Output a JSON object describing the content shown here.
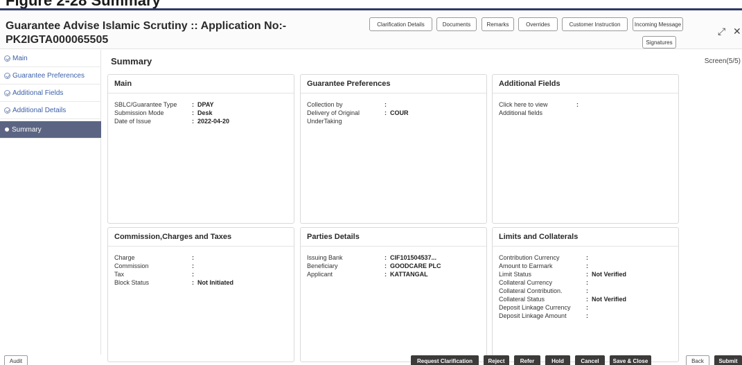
{
  "doc_heading": "Figure 2-28   Summary",
  "window": {
    "title_line1": "Guarantee Advise Islamic Scrutiny :: Application No:-",
    "title_line2": "PK2IGTA000065505",
    "header_buttons": [
      "Clarification Details",
      "Documents",
      "Remarks",
      "Overrides",
      "Customer Instruction",
      "Incoming Message"
    ],
    "signatures_label": "Signatures",
    "expand_icon": "expand-icon",
    "close_icon": "close-icon",
    "expand_glyph": "⤢",
    "close_glyph": "✕"
  },
  "sidebar": {
    "items": [
      {
        "label": "Main",
        "done": true
      },
      {
        "label": "Guarantee Preferences",
        "done": true
      },
      {
        "label": "Additional Fields",
        "done": true
      },
      {
        "label": "Additional Details",
        "done": true
      },
      {
        "label": "Summary",
        "active": true
      }
    ]
  },
  "page": {
    "title": "Summary",
    "screen_indicator": "Screen(5/5)"
  },
  "cards": {
    "main": {
      "title": "Main",
      "rows": [
        {
          "label": "SBLC/Guarantee Type",
          "sep": ":",
          "value": "DPAY"
        },
        {
          "label": "Submission Mode",
          "sep": ":",
          "value": "Desk"
        },
        {
          "label": "Date of Issue",
          "sep": ":",
          "value": "2022-04-20"
        }
      ]
    },
    "guarantee_preferences": {
      "title": "Guarantee Preferences",
      "rows": [
        {
          "label": "Collection by",
          "sep": ":",
          "value": ""
        },
        {
          "label": "Delivery of Original UnderTaking",
          "sep": ":",
          "value": "COUR"
        }
      ]
    },
    "additional_fields": {
      "title": "Additional Fields",
      "rows": [
        {
          "label": "Click here to view Additional fields",
          "sep": ":",
          "value": ""
        }
      ]
    },
    "commission": {
      "title": "Commission,Charges and Taxes",
      "rows": [
        {
          "label": "Charge",
          "sep": ":",
          "value": ""
        },
        {
          "label": "Commission",
          "sep": ":",
          "value": ""
        },
        {
          "label": "Tax",
          "sep": ":",
          "value": ""
        },
        {
          "label": "Block Status",
          "sep": ":",
          "value": "Not Initiated"
        }
      ]
    },
    "parties": {
      "title": "Parties Details",
      "rows": [
        {
          "label": "Issuing Bank",
          "sep": ":",
          "value": "CIF101504537..."
        },
        {
          "label": "Beneficiary",
          "sep": ":",
          "value": "GOODCARE PLC"
        },
        {
          "label": "Applicant",
          "sep": ":",
          "value": "KATTANGAL"
        }
      ]
    },
    "limits": {
      "title": "Limits and Collaterals",
      "rows": [
        {
          "label": "Contribution Currency",
          "sep": ":",
          "value": ""
        },
        {
          "label": "Amount to Earmark",
          "sep": ":",
          "value": ""
        },
        {
          "label": "Limit Status",
          "sep": ":",
          "value": "Not Verified"
        },
        {
          "label": "Collateral Currency",
          "sep": ":",
          "value": ""
        },
        {
          "label": "Collateral Contribution.",
          "sep": ":",
          "value": ""
        },
        {
          "label": "Collateral Status",
          "sep": ":",
          "value": "Not Verified"
        },
        {
          "label": "Deposit Linkage Currency",
          "sep": ":",
          "value": ""
        },
        {
          "label": "Deposit Linkage Amount",
          "sep": ":",
          "value": ""
        }
      ]
    }
  },
  "footer": {
    "audit_label": "Audit",
    "actions": [
      "Request Clarification",
      "Reject",
      "Refer",
      "Hold",
      "Cancel",
      "Save & Close",
      "Back",
      "Submit"
    ]
  },
  "colors": {
    "sidebar_active": "#5b6583",
    "nav_link": "#3b5fa8",
    "action_button": "#3d3a3a"
  }
}
